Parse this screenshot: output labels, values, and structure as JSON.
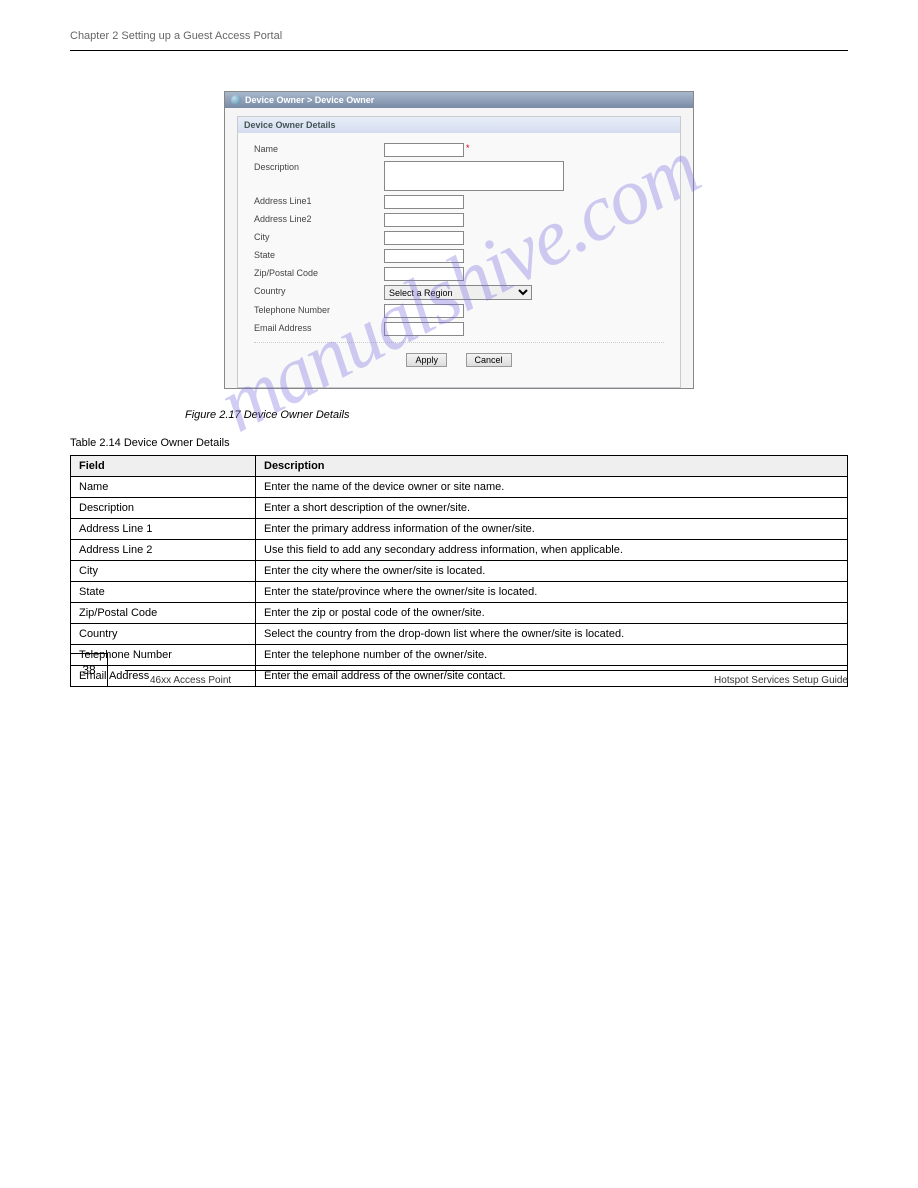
{
  "page_header": "Chapter 2 Setting up a Guest Access Portal",
  "screenshot": {
    "breadcrumb": "Device Owner > Device Owner",
    "panel_title": "Device Owner Details",
    "fields": {
      "name_label": "Name",
      "description_label": "Description",
      "addr1_label": "Address Line1",
      "addr2_label": "Address Line2",
      "city_label": "City",
      "state_label": "State",
      "zip_label": "Zip/Postal Code",
      "country_label": "Country",
      "telephone_label": "Telephone Number",
      "email_label": "Email Address"
    },
    "country_placeholder": "Select a Region",
    "buttons": {
      "apply": "Apply",
      "cancel": "Cancel"
    }
  },
  "figure_caption": "Figure 2.17 Device Owner Details",
  "table_caption": "Table 2.14 Device Owner Details",
  "table": {
    "header": [
      "Field",
      "Description"
    ],
    "rows": [
      [
        "Name",
        "Enter the name of the device owner or site name."
      ],
      [
        "Description",
        "Enter a short description of the owner/site."
      ],
      [
        "Address Line 1",
        "Enter the primary address information of the owner/site."
      ],
      [
        "Address Line 2",
        "Use this field to add any secondary address information, when applicable."
      ],
      [
        "City",
        "Enter the city where the owner/site is located."
      ],
      [
        "State",
        "Enter the state/province where the owner/site is located."
      ],
      [
        "Zip/Postal Code",
        "Enter the zip or postal code of the owner/site."
      ],
      [
        "Country",
        "Select the country from the drop-down list where the owner/site is located."
      ],
      [
        "Telephone Number",
        "Enter the telephone number of the owner/site."
      ],
      [
        "Email Address",
        "Enter the email address of the owner/site contact."
      ]
    ]
  },
  "watermark": "manualshive.com",
  "footer": {
    "page_number": "38",
    "left": "46xx Access Point",
    "right": "Hotspot Services Setup Guide"
  }
}
